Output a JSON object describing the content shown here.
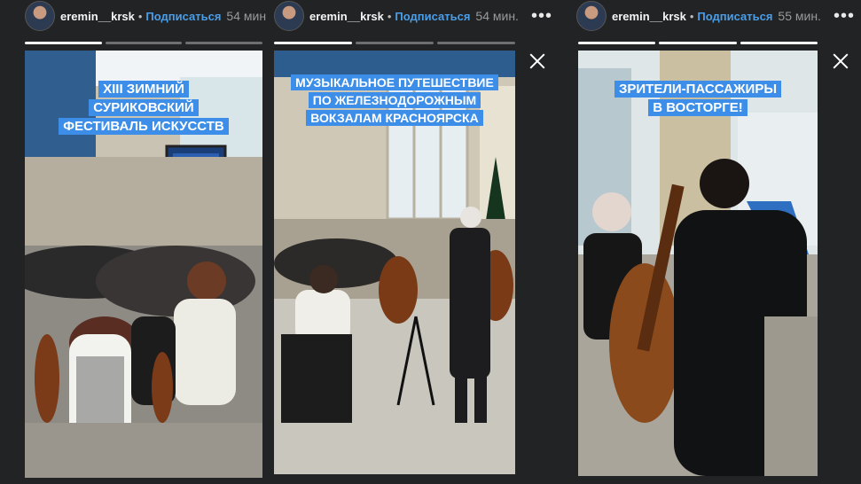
{
  "stories": [
    {
      "username": "eremin__krsk",
      "separator": "•",
      "follow_label": "Подписаться",
      "time": "54 мин",
      "caption_lines": [
        "XIII ЗИМНИЙ",
        "СУРИКОВСКИЙ",
        "ФЕСТИВАЛЬ ИСКУССТВ"
      ],
      "progress_segments": 3,
      "progress_done": 1
    },
    {
      "username": "eremin__krsk",
      "separator": "•",
      "follow_label": "Подписаться",
      "time": "54 мин.",
      "more": "•••",
      "caption_lines": [
        "МУЗЫКАЛЬНОЕ ПУТЕШЕСТВИЕ",
        "ПО ЖЕЛЕЗНОДОРОЖНЫМ",
        "ВОКЗАЛАМ КРАСНОЯРСКА"
      ],
      "progress_segments": 3,
      "progress_done": 1
    },
    {
      "username": "eremin__krsk",
      "separator": "•",
      "follow_label": "Подписаться",
      "time": "55 мин.",
      "more": "•••",
      "caption_lines": [
        "ЗРИТЕЛИ-ПАССАЖИРЫ",
        "В ВОСТОРГЕ!"
      ],
      "progress_segments": 3,
      "progress_done": 3
    }
  ],
  "colors": {
    "background": "#222325",
    "accent_blue": "#3d8ee8",
    "follow_blue": "#4a9ee8"
  },
  "icons": {
    "close": "close-icon",
    "more": "more-icon"
  }
}
